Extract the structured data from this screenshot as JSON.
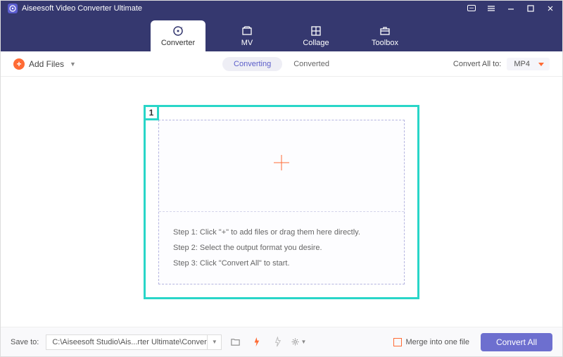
{
  "app": {
    "title": "Aiseesoft Video Converter Ultimate"
  },
  "tabs": {
    "converter": "Converter",
    "mv": "MV",
    "collage": "Collage",
    "toolbox": "Toolbox"
  },
  "subbar": {
    "add_files": "Add Files",
    "converting": "Converting",
    "converted": "Converted",
    "convert_all_to": "Convert All to:",
    "format": "MP4"
  },
  "highlight": {
    "number": "1"
  },
  "steps": {
    "s1": "Step 1: Click \"+\" to add files or drag them here directly.",
    "s2": "Step 2: Select the output format you desire.",
    "s3": "Step 3: Click \"Convert All\" to start."
  },
  "bottom": {
    "save_to": "Save to:",
    "path": "C:\\Aiseesoft Studio\\Ais...rter Ultimate\\Converted",
    "merge": "Merge into one file",
    "convert_all": "Convert All"
  }
}
